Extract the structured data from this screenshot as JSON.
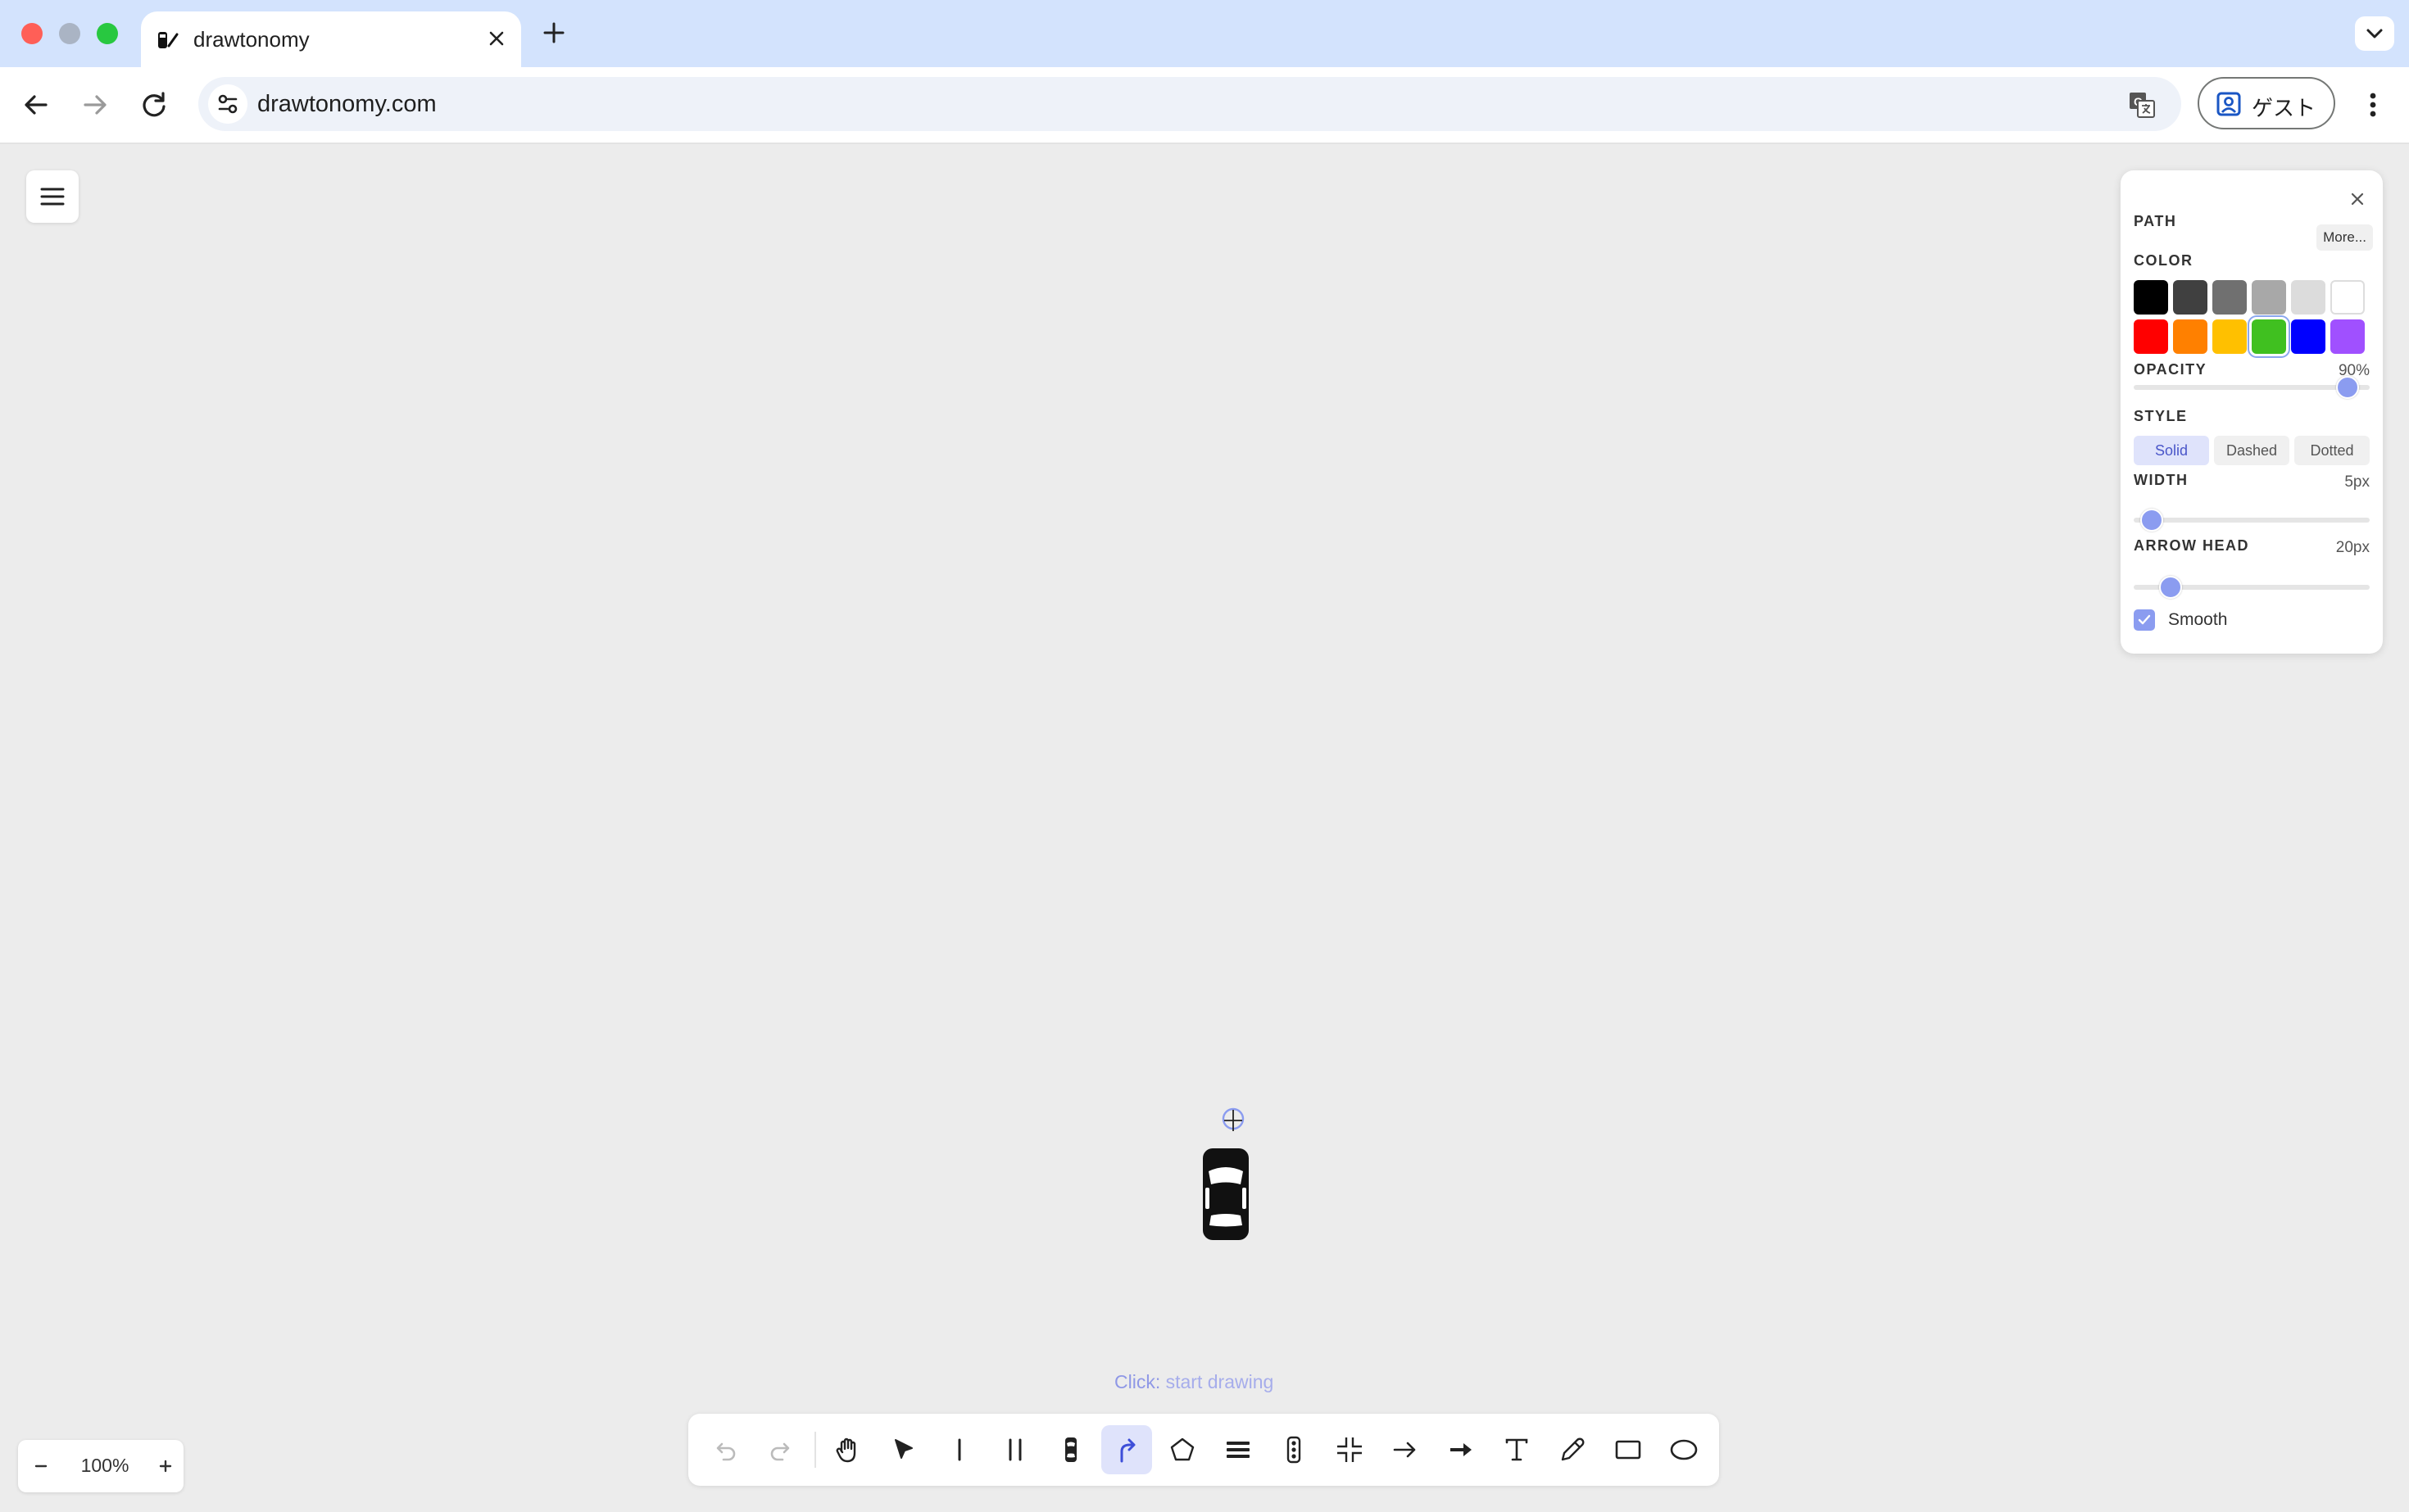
{
  "browser": {
    "tab_title": "drawtonomy",
    "url": "drawtonomy.com",
    "profile_label": "ゲスト"
  },
  "panel": {
    "title": "PATH",
    "color_label": "COLOR",
    "more_label": "More...",
    "colors_row1": [
      "#000000",
      "#404040",
      "#707070",
      "#a8a8a8",
      "#dcdcdc",
      "#ffffff"
    ],
    "colors_row2": [
      "#ff0000",
      "#ff8000",
      "#ffc000",
      "#40c020",
      "#0000ff",
      "#a050ff"
    ],
    "selected_color": "#40c020",
    "opacity_label": "OPACITY",
    "opacity_value": "90%",
    "opacity_fraction": 0.9,
    "style_label": "STYLE",
    "style_options": [
      "Solid",
      "Dashed",
      "Dotted"
    ],
    "style_selected": "Solid",
    "width_label": "WIDTH",
    "width_value": "5px",
    "width_fraction": 0.05,
    "arrowhead_label": "ARROW HEAD",
    "arrowhead_value": "20px",
    "arrowhead_fraction": 0.15,
    "smooth_label": "Smooth",
    "smooth_checked": true
  },
  "hint": {
    "action": "Click:",
    "text": "start drawing"
  },
  "toolbar": {
    "active_tool": "path",
    "tools": [
      "undo-icon",
      "redo-icon",
      "hand-icon",
      "select-icon",
      "line-icon",
      "double-line-icon",
      "car-icon",
      "path-icon",
      "polygon-icon",
      "lanes-icon",
      "traffic-light-icon",
      "intersection-icon",
      "arrow-icon",
      "bold-arrow-icon",
      "text-icon",
      "pencil-icon",
      "rectangle-icon",
      "ellipse-icon"
    ]
  },
  "zoom": {
    "minus": "−",
    "level": "100%",
    "plus": "+"
  },
  "accent_color": "#8b9cf0"
}
